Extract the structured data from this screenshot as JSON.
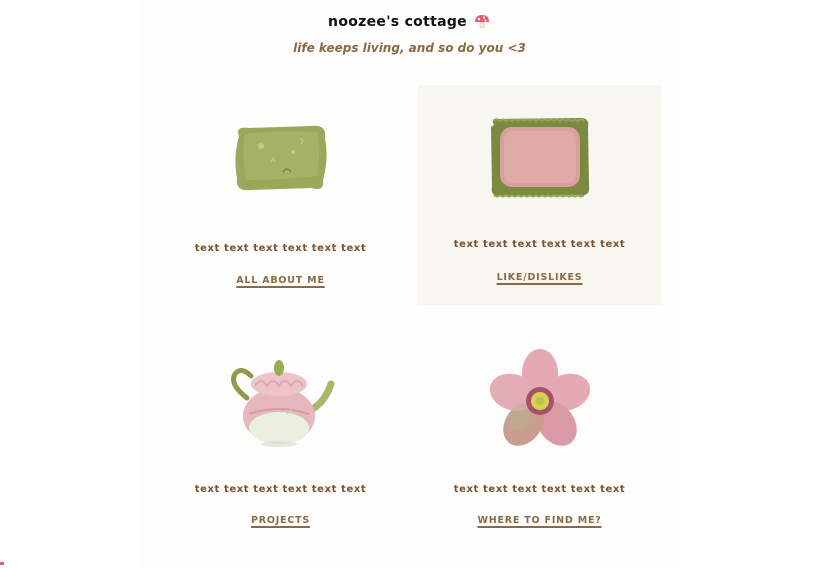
{
  "header": {
    "title": "noozee's cottage",
    "title_icon": "mushroom-icon",
    "subtitle": "life keeps living, and so do you <3"
  },
  "cards": [
    {
      "image": "green-pillow-image",
      "text": "text text text text text text",
      "link": "ALL ABOUT ME"
    },
    {
      "image": "pink-ruffle-pillow-image",
      "text": "text text text text text text",
      "link": "LIKE/DISLIKES"
    },
    {
      "image": "floral-teapot-image",
      "text": "text text text text text text",
      "link": "PROJECTS"
    },
    {
      "image": "hellebore-flower-image",
      "text": "text text text text text text",
      "link": "WHERE TO FIND ME?"
    }
  ],
  "colors": {
    "accent_brown": "#8a6a43",
    "text_brown": "#7a5230",
    "highlight_bg": "#f8f6f0"
  }
}
